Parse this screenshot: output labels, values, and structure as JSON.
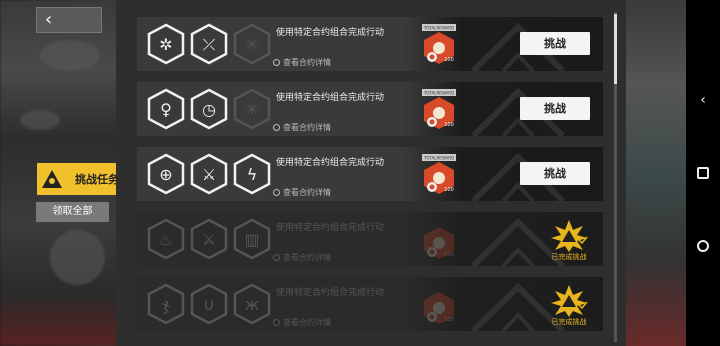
{
  "nav": {
    "back_icon": "‹"
  },
  "sidebar": {
    "tab_label": "挑战任务",
    "claim_all_label": "领取全部"
  },
  "colors": {
    "accent": "#f0c12c",
    "badge_red": "#d84a2a",
    "complete_gold": "#e8b51c"
  },
  "missions": [
    {
      "title": "使用特定合约组合完成行动",
      "detail": "查看合约详情",
      "badge_tag": "TOTALREWARD",
      "badge_value": "100",
      "icons": [
        "snowflake-crest-icon",
        "crossed-arrows-icon",
        "snowflake-faded-icon"
      ],
      "action": "挑战",
      "completed": false
    },
    {
      "title": "使用特定合约组合完成行动",
      "detail": "查看合约详情",
      "badge_tag": "TOTALREWARD",
      "badge_value": "100",
      "icons": [
        "figure-in-circle-icon",
        "clock-target-icon",
        "snowflake-faded-icon"
      ],
      "action": "挑战",
      "completed": false
    },
    {
      "title": "使用特定合约组合完成行动",
      "detail": "查看合约详情",
      "badge_tag": "TOTALREWARD",
      "badge_value": "100",
      "icons": [
        "target-arrows-icon",
        "crossed-swords-icon",
        "lightning-icon"
      ],
      "action": "挑战",
      "completed": false
    },
    {
      "title": "使用特定合约组合完成行动",
      "detail": "查看合约详情",
      "badge_tag": "",
      "badge_value": "100",
      "icons": [
        "fire-icon",
        "crossed-swords-icon",
        "fence-icon"
      ],
      "action": "已完成挑战",
      "completed": true
    },
    {
      "title": "使用特定合约组合完成行动",
      "detail": "查看合约详情",
      "badge_tag": "",
      "badge_value": "100",
      "icons": [
        "squid-icon",
        "magnet-plus-icon",
        "creature-icon"
      ],
      "action": "已完成挑战",
      "completed": true
    }
  ]
}
